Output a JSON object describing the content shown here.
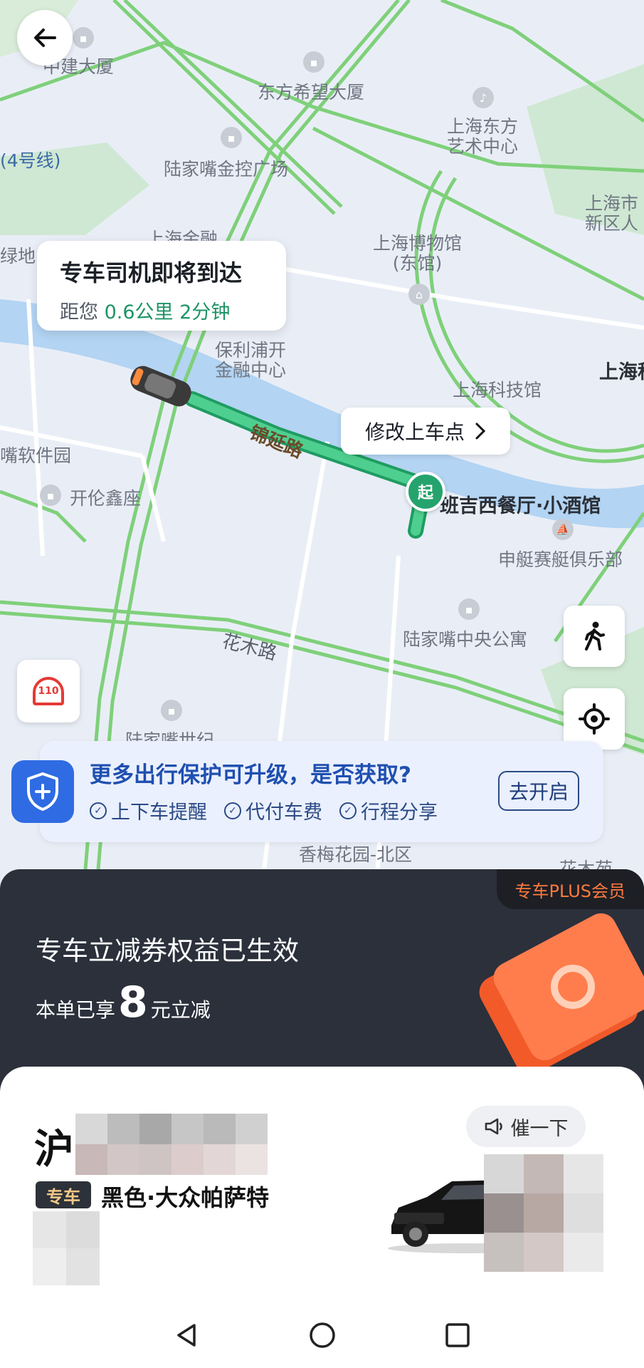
{
  "map": {
    "labels": {
      "jianzhu": "中建大厦",
      "dongfang_xiwang": "东方希望大厦",
      "art_center": "上海东方\n艺术中心",
      "line4": "(4号线)",
      "jinkong": "陆家嘴金控广场",
      "xinqu": "上海市\n新区人",
      "jinrong": "上海金融",
      "lvdi": "绿地",
      "museum": "上海博物馆\n(东馆)",
      "baoli": "保利浦开\n金融中心",
      "kejiguan": "上海科技馆",
      "shangheke": "上海科",
      "ruanjianyuan": "嘴软件园",
      "road_jinyan": "锦延路",
      "kailun": "开伦鑫座",
      "restaurant": "班吉西餐厅·小酒馆",
      "yacht": "申艇赛艇俱乐部",
      "apartment": "陆家嘴中央公寓",
      "road_huamu": "花木路",
      "shiji": "陆家嘴世纪",
      "xiangmei": "香梅花园-北区",
      "huamuyuan": "花木苑"
    },
    "pickup_marker": "起"
  },
  "arrival": {
    "title": "专车司机即将到达",
    "prefix": "距您",
    "distance": "0.6公里",
    "time": "2分钟"
  },
  "pickup_edit": {
    "label": "修改上车点"
  },
  "sos_label": "110",
  "protection": {
    "title": "更多出行保护可升级，是否获取?",
    "items": [
      "上下车提醒",
      "代付车费",
      "行程分享"
    ],
    "button": "去开启"
  },
  "plus": {
    "badge": "专车PLUS会员",
    "title": "专车立减券权益已生效",
    "sub_prefix": "本单已享",
    "amount": "8",
    "sub_suffix": "元立减"
  },
  "driver": {
    "plate_prefix": "沪",
    "urge_button": "催一下",
    "car_tag": "专车",
    "car_model": "黑色·大众帕萨特"
  },
  "colors": {
    "route": "#3fbf7f",
    "road": "#7fd07a",
    "water": "#b3d4f3",
    "accent_blue": "#2f6be3",
    "plus_orange": "#ff7a3d"
  }
}
